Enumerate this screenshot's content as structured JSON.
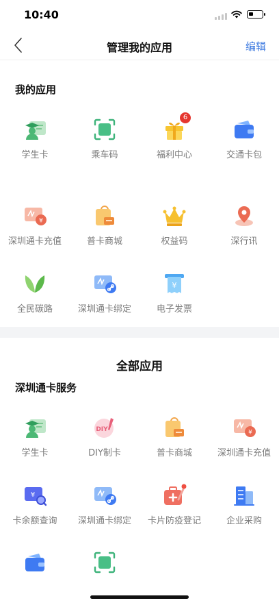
{
  "status_bar": {
    "time": "10:40"
  },
  "nav": {
    "title": "管理我的应用",
    "edit_label": "编辑"
  },
  "my_apps": {
    "title": "我的应用",
    "items": [
      {
        "label": "学生卡",
        "icon": "student-card-icon"
      },
      {
        "label": "乘车码",
        "icon": "ride-code-icon"
      },
      {
        "label": "福利中心",
        "icon": "gift-icon",
        "badge": "6"
      },
      {
        "label": "交通卡包",
        "icon": "wallet-icon"
      },
      {
        "label": "深圳通卡充值",
        "icon": "card-recharge-icon"
      },
      {
        "label": "普卡商城",
        "icon": "shopping-bag-icon"
      },
      {
        "label": "权益码",
        "icon": "crown-icon"
      },
      {
        "label": "深行讯",
        "icon": "location-pin-icon"
      },
      {
        "label": "全民碳路",
        "icon": "leaf-icon"
      },
      {
        "label": "深圳通卡绑定",
        "icon": "card-link-icon"
      },
      {
        "label": "电子发票",
        "icon": "invoice-icon"
      }
    ]
  },
  "all_apps": {
    "title": "全部应用",
    "subsection_title": "深圳通卡服务",
    "items": [
      {
        "label": "学生卡",
        "icon": "student-card-icon"
      },
      {
        "label": "DIY制卡",
        "icon": "diy-card-icon"
      },
      {
        "label": "普卡商城",
        "icon": "shopping-bag-icon"
      },
      {
        "label": "深圳通卡充值",
        "icon": "card-recharge-icon"
      },
      {
        "label": "卡余额查询",
        "icon": "balance-search-icon"
      },
      {
        "label": "深圳通卡绑定",
        "icon": "card-link-icon"
      },
      {
        "label": "卡片防疫登记",
        "icon": "medical-kit-icon"
      },
      {
        "label": "企业采购",
        "icon": "building-icon"
      },
      {
        "label": "",
        "icon": "wallet-icon"
      },
      {
        "label": "",
        "icon": "ride-code-icon"
      }
    ]
  },
  "colors": {
    "accent": "#3f7be0",
    "badge": "#e5362f",
    "divider": "#f3f4f6"
  }
}
